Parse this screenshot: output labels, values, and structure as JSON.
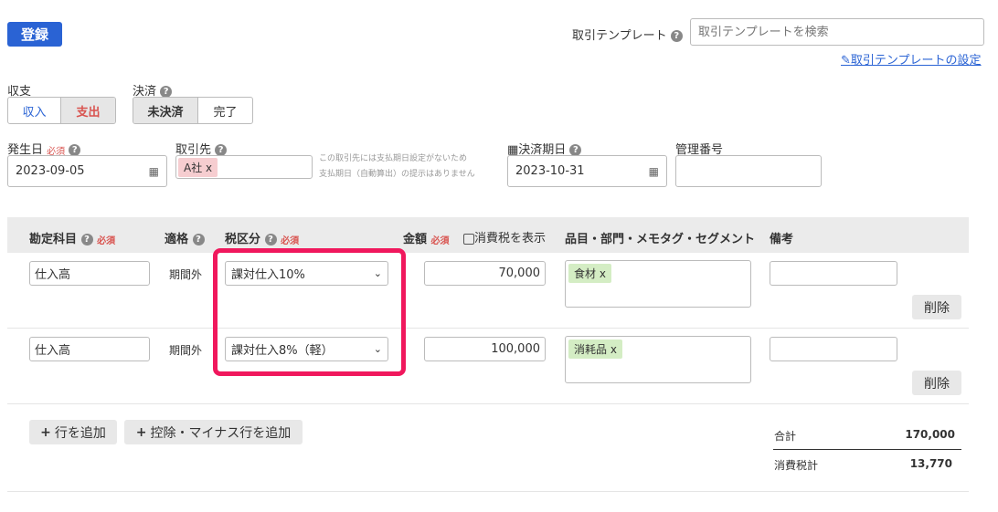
{
  "header": {
    "register_label": "登録",
    "template_label": "取引テンプレート",
    "template_placeholder": "取引テンプレートを検索",
    "template_settings_link": "取引テンプレートの設定"
  },
  "income_expense": {
    "label": "収支",
    "options": [
      "収入",
      "支出"
    ],
    "selected": "支出"
  },
  "settlement": {
    "label": "決済",
    "options": [
      "未決済",
      "完了"
    ],
    "selected": "未決済"
  },
  "fields": {
    "issue_date_label": "発生日",
    "required": "必須",
    "issue_date": "2023-09-05",
    "partner_label": "取引先",
    "partner_tag": "A社",
    "partner_note_line1": "この取引先には支払期日設定がないため",
    "partner_note_line2": "支払期日（自動算出）の提示はありません",
    "due_date_label": "決済期日",
    "due_date": "2023-10-31",
    "mgmt_no_label": "管理番号",
    "mgmt_no": ""
  },
  "table": {
    "headers": {
      "account": "勘定科目",
      "qualified": "適格",
      "tax": "税区分",
      "amount": "金額",
      "show_tax": "消費税を表示",
      "items": "品目・部門・メモタグ・セグメント",
      "note": "備考"
    },
    "rows": [
      {
        "account": "仕入高",
        "qualified": "期間外",
        "tax": "課対仕入10%",
        "amount": "70,000",
        "tag": "食材",
        "note": "",
        "delete": "削除"
      },
      {
        "account": "仕入高",
        "qualified": "期間外",
        "tax": "課対仕入8%（軽）",
        "amount": "100,000",
        "tag": "消耗品",
        "note": "",
        "delete": "削除"
      }
    ],
    "tag_remove": "x"
  },
  "actions": {
    "add_row": "行を追加",
    "add_deduction": "控除・マイナス行を追加"
  },
  "totals": {
    "total_label": "合計",
    "total_value": "170,000",
    "tax_label": "消費税計",
    "tax_value": "13,770"
  },
  "colors": {
    "primary": "#2a63d4",
    "highlight": "#f0185d",
    "required": "#d9534f",
    "tag_green": "#d4edc4",
    "tag_red": "#f6cdd0"
  }
}
